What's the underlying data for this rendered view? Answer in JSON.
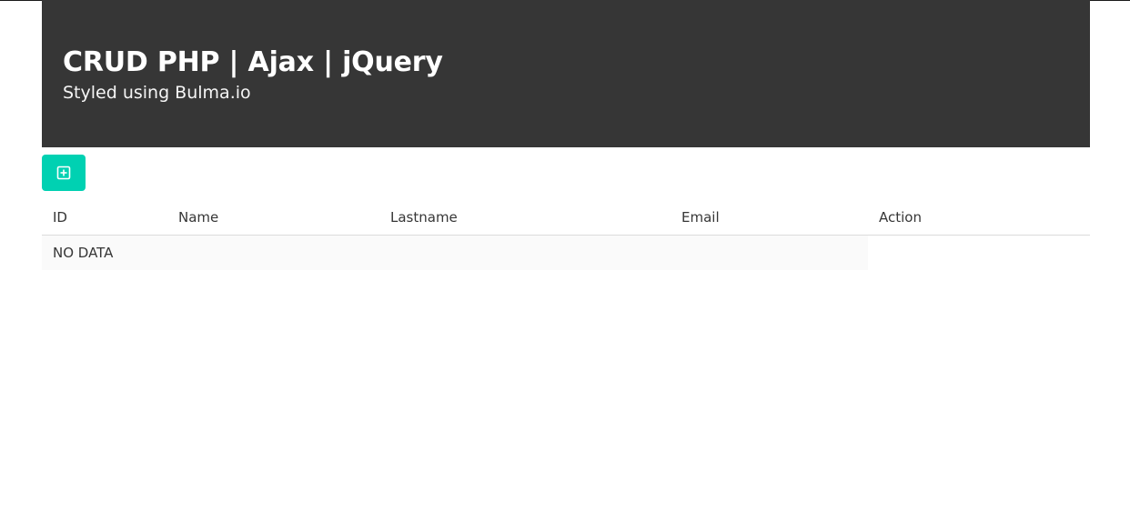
{
  "hero": {
    "title": "CRUD PHP | Ajax | jQuery",
    "subtitle": "Styled using Bulma.io"
  },
  "toolbar": {
    "add_icon": "plus-square-icon",
    "accent_color": "#00d1b2"
  },
  "table": {
    "columns": [
      "ID",
      "Name",
      "Lastname",
      "Email",
      "Action"
    ],
    "empty_message": "NO DATA"
  },
  "colors": {
    "hero_background": "#363636",
    "hero_text": "#ffffff",
    "row_stripe": "#fafafa"
  }
}
